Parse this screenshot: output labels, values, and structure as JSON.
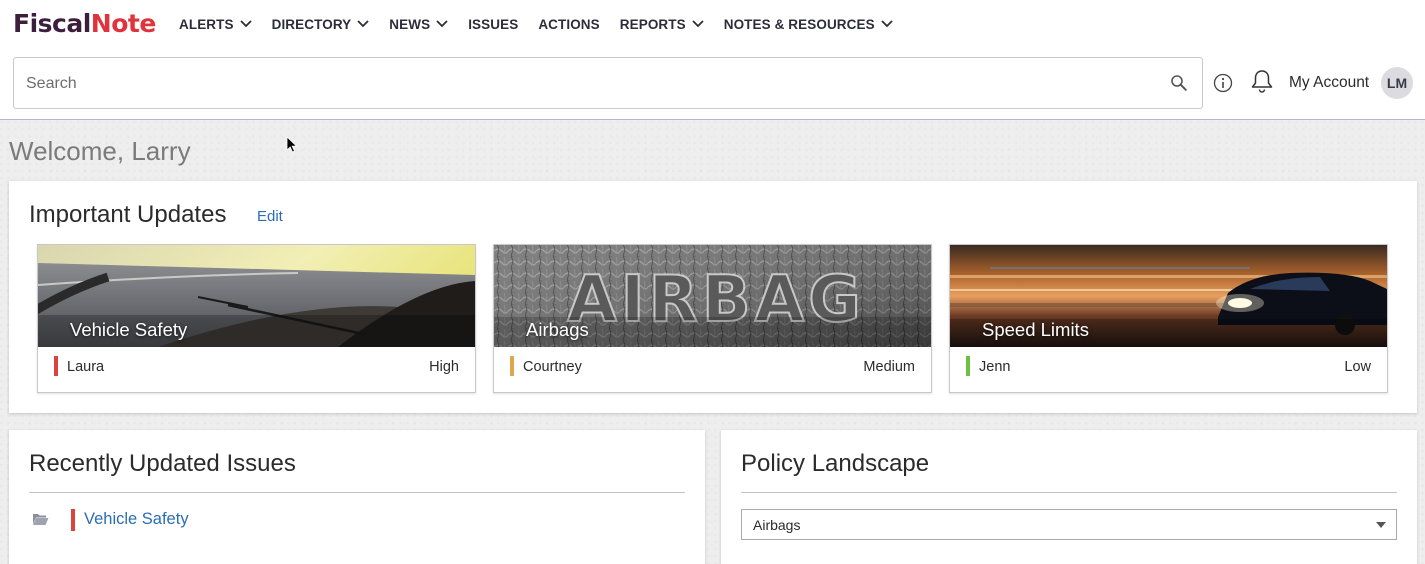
{
  "brand": {
    "part1": "Fiscal",
    "part2": "Note"
  },
  "nav": [
    {
      "label": "ALERTS",
      "has_dropdown": true
    },
    {
      "label": "DIRECTORY",
      "has_dropdown": true
    },
    {
      "label": "NEWS",
      "has_dropdown": true
    },
    {
      "label": "ISSUES",
      "has_dropdown": false
    },
    {
      "label": "ACTIONS",
      "has_dropdown": false
    },
    {
      "label": "REPORTS",
      "has_dropdown": true
    },
    {
      "label": "NOTES & RESOURCES",
      "has_dropdown": true
    }
  ],
  "search": {
    "placeholder": "Search",
    "value": ""
  },
  "account": {
    "label": "My Account",
    "initials": "LM"
  },
  "welcome": "Welcome, Larry",
  "important_updates": {
    "title": "Important Updates",
    "edit_label": "Edit",
    "cards": [
      {
        "title": "Vehicle Safety",
        "owner": "Laura",
        "priority": "High",
        "priority_color": "#d9443e",
        "image": "road-windshield"
      },
      {
        "title": "Airbags",
        "owner": "Courtney",
        "priority": "Medium",
        "priority_color": "#e0a64a",
        "image": "airbag-leather"
      },
      {
        "title": "Speed Limits",
        "owner": "Jenn",
        "priority": "Low",
        "priority_color": "#6cbf3f",
        "image": "speeding-car"
      }
    ]
  },
  "recent_issues": {
    "title": "Recently Updated Issues",
    "items": [
      {
        "label": "Vehicle Safety",
        "color": "#d9443e"
      }
    ]
  },
  "policy_landscape": {
    "title": "Policy Landscape",
    "selected": "Airbags"
  }
}
